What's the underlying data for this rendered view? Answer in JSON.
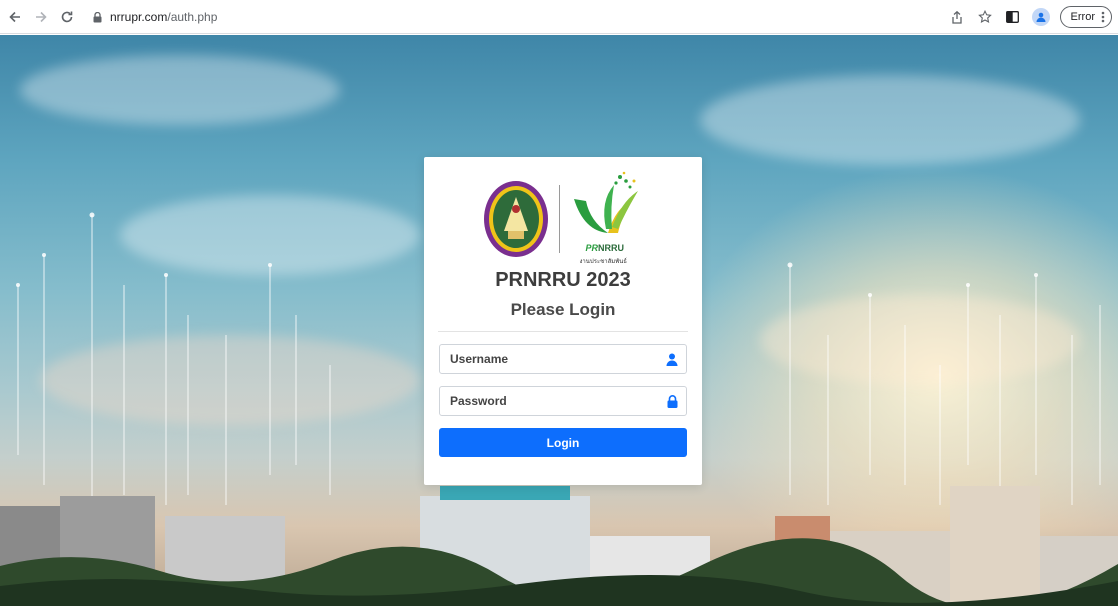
{
  "browser": {
    "url_host": "nrrupr.com",
    "url_path": "/auth.php",
    "error_label": "Error"
  },
  "card": {
    "logo_pr": "PR",
    "logo_nrru": "NRRU",
    "logo_sub": "งานประชาสัมพันธ์",
    "title": "PRNRRU 2023",
    "subtitle": "Please Login",
    "username_placeholder": "Username",
    "password_placeholder": "Password",
    "login_label": "Login"
  },
  "colors": {
    "primary": "#0d6efd",
    "logo_green": "#2a9d3f",
    "logo_yellow": "#e8c21d"
  },
  "icons": {
    "back": "arrow-left-icon",
    "forward": "arrow-right-icon",
    "reload": "reload-icon",
    "lock": "lock-icon",
    "share": "share-icon",
    "bookmark": "star-icon",
    "sidepanel": "side-panel-icon",
    "profile": "profile-icon",
    "menu": "kebab-menu-icon",
    "user_field": "user-icon",
    "password_field": "padlock-icon"
  }
}
